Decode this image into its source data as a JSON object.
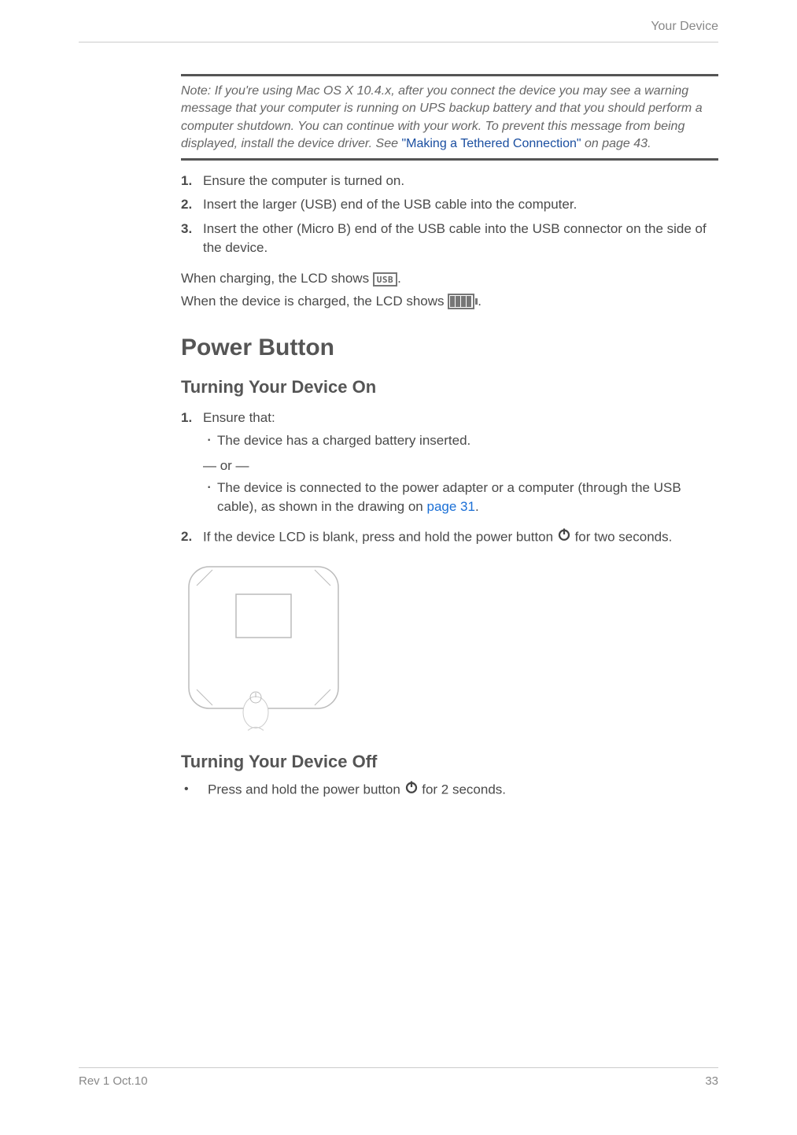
{
  "header": {
    "chapter": "Your Device"
  },
  "note": {
    "label": "Note:",
    "text_before": "If you're using Mac OS X 10.4.x, after you connect the device you may see a warning message that your computer is running on UPS backup battery and that you should perform a computer shutdown. You can continue with your work. To prevent this message from being displayed, install the device driver. See ",
    "xref": "\"Making a Tethered Connection\"",
    "text_after": " on page 43."
  },
  "charging": {
    "steps": [
      "Ensure the computer is turned on.",
      "Insert the larger (USB) end of the USB cable into the computer.",
      "Insert the other (Micro B) end of the USB cable into the USB connector on the side of the device."
    ],
    "usb_label": "USB",
    "line_charging_a": "When charging, the LCD shows ",
    "line_charging_b": ".",
    "line_charged_a": "When the device is charged, the LCD shows ",
    "line_charged_b": "."
  },
  "section_power": {
    "title": "Power Button"
  },
  "turn_on": {
    "title": "Turning Your Device On",
    "step1_label": "Ensure that:",
    "bullet1": "The device has a charged battery inserted.",
    "or_text": "— or —",
    "bullet2_a": "The device is connected to the power adapter or a computer (through the USB cable), as shown in the drawing on ",
    "bullet2_link": "page 31",
    "bullet2_b": ".",
    "step2_a": "If the device LCD is blank, press and hold the power button ",
    "step2_b": " for two seconds."
  },
  "turn_off": {
    "title": "Turning Your Device Off",
    "bullet_a": "Press and hold the power button ",
    "bullet_b": "  for 2 seconds."
  },
  "footer": {
    "left": "Rev 1  Oct.10",
    "right": "33"
  }
}
